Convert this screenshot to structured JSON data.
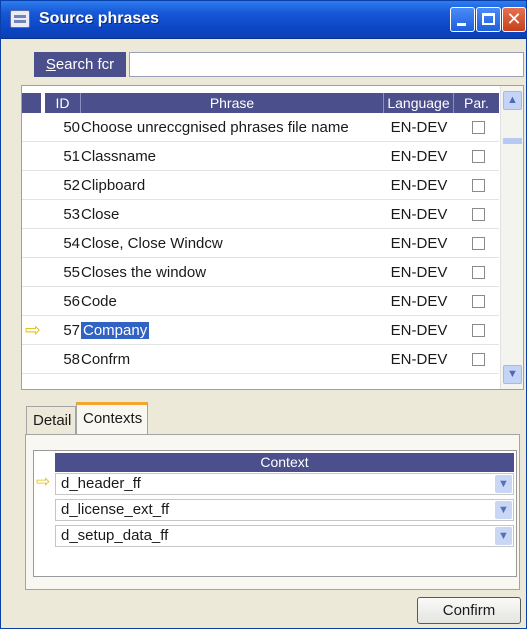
{
  "window": {
    "title": "Source phrases",
    "icons": {
      "app": "app-window-icon",
      "minimize": "minimize-icon",
      "maximize": "maximize-icon",
      "close": "close-icon"
    }
  },
  "search": {
    "label_prefix": "S",
    "label_rest": "earch fcr",
    "value": ""
  },
  "grid": {
    "columns": {
      "id": "ID",
      "phrase": "Phrase",
      "language": "Language",
      "par": "Par."
    },
    "rows": [
      {
        "id": "50",
        "phrase": "Choose unreccgnised phrases file name",
        "language": "EN-DEV",
        "par": false,
        "current": false
      },
      {
        "id": "51",
        "phrase": "Classname",
        "language": "EN-DEV",
        "par": false,
        "current": false
      },
      {
        "id": "52",
        "phrase": "Clipboard",
        "language": "EN-DEV",
        "par": false,
        "current": false
      },
      {
        "id": "53",
        "phrase": "Close",
        "language": "EN-DEV",
        "par": false,
        "current": false
      },
      {
        "id": "54",
        "phrase": "Close, Close Windcw",
        "language": "EN-DEV",
        "par": false,
        "current": false
      },
      {
        "id": "55",
        "phrase": "Closes the window",
        "language": "EN-DEV",
        "par": false,
        "current": false
      },
      {
        "id": "56",
        "phrase": "Code",
        "language": "EN-DEV",
        "par": false,
        "current": false
      },
      {
        "id": "57",
        "phrase": "Company",
        "language": "EN-DEV",
        "par": false,
        "current": true
      },
      {
        "id": "58",
        "phrase": "Confrm",
        "language": "EN-DEV",
        "par": false,
        "current": false
      }
    ],
    "current_row_icon": "current-row-arrow-icon"
  },
  "tabs": {
    "detail": "Detail",
    "contexts": "Contexts",
    "active": "contexts"
  },
  "contexts": {
    "column": "Context",
    "rows": [
      {
        "value": "d_header_ff",
        "current": true
      },
      {
        "value": "d_license_ext_ff",
        "current": false
      },
      {
        "value": "d_setup_data_ff",
        "current": false
      }
    ]
  },
  "buttons": {
    "confirm": "Confirm"
  },
  "colors": {
    "title_bar": "#0c47c6",
    "header_fill": "#4b4f8c",
    "selection": "#3163c5",
    "tab_accent": "#f0a631",
    "row_arrow": "#e3c100"
  }
}
